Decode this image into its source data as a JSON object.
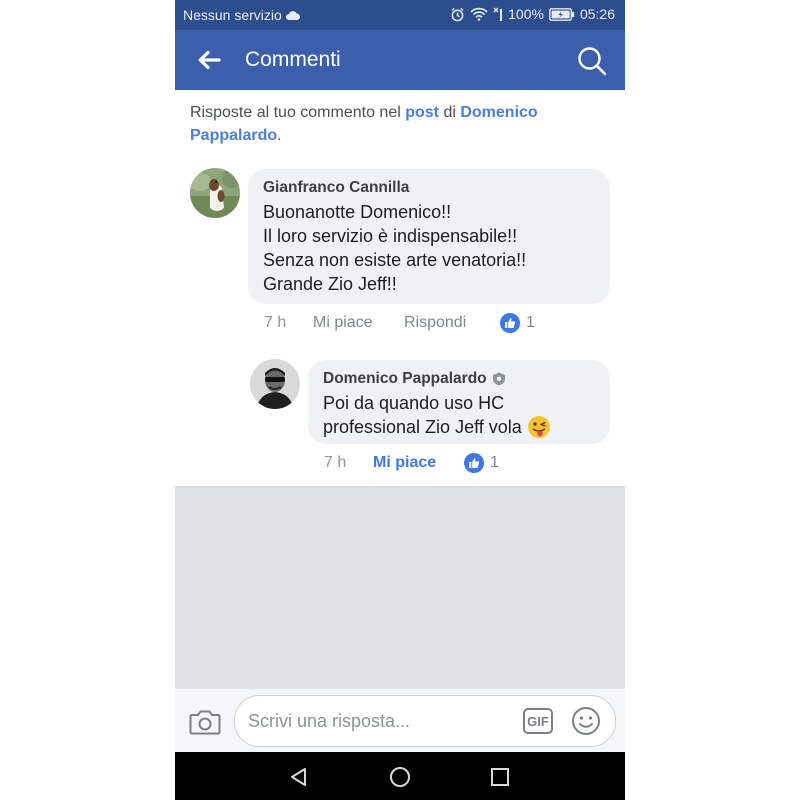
{
  "status_bar": {
    "carrier": "Nessun servizio",
    "battery": "100%",
    "time": "05:26"
  },
  "app_bar": {
    "title": "Commenti"
  },
  "context": {
    "prefix": "Risposte al tuo commento nel ",
    "post_link": "post",
    "middle": " di ",
    "author_link": "Domenico Pappalardo",
    "suffix": "."
  },
  "comments": [
    {
      "author": "Gianfranco Cannilla",
      "lines": [
        "Buonanotte Domenico!!",
        "Il loro servizio è indispensabile!!",
        "Senza non esiste arte venatoria!!",
        "Grande Zio Jeff!!"
      ],
      "time": "7 h",
      "like_label": "Mi piace",
      "reply_label": "Rispondi",
      "like_count": "1",
      "liked": false
    },
    {
      "author": "Domenico Pappalardo",
      "lines": [
        "Poi da quando uso HC",
        "professional Zio Jeff vola"
      ],
      "time": "7 h",
      "like_label": "Mi piace",
      "like_count": "1",
      "liked": true
    }
  ],
  "composer": {
    "placeholder": "Scrivi una risposta...",
    "gif_label": "GIF"
  },
  "colors": {
    "status_bar": "#2c4d8e",
    "app_bar": "#3b5fac",
    "link": "#4a7ee0",
    "bubble": "#f0f1f4",
    "like_badge": "#3f78e6"
  }
}
